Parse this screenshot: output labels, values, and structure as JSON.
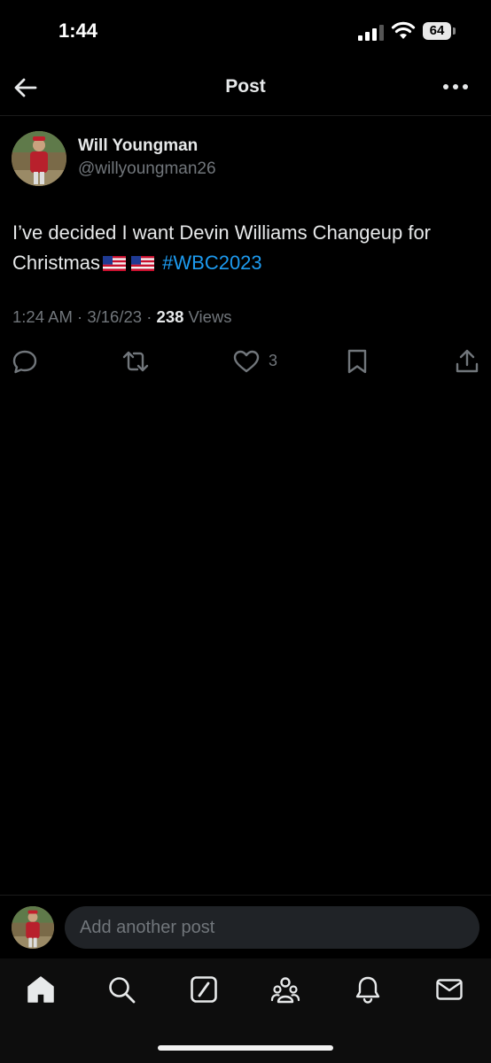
{
  "status_bar": {
    "time": "1:44",
    "battery": "64"
  },
  "header": {
    "title": "Post"
  },
  "post": {
    "author_name": "Will Youngman",
    "author_handle": "@willyoungman26",
    "text": "I’ve decided I want Devin Williams Changeup for Christmas",
    "hashtag": "#WBC2023",
    "time": "1:24 AM",
    "date": "3/16/23",
    "views_count": "238",
    "views_label": "Views",
    "like_count": "3"
  },
  "reply": {
    "placeholder": "Add another post"
  },
  "colors": {
    "background": "#000000",
    "accent": "#1d9bf0",
    "muted": "#71767b",
    "text": "#e7e9ea"
  },
  "icons": {
    "header": [
      "back-arrow-icon",
      "more-options-icon"
    ],
    "actions": [
      "reply-icon",
      "repost-icon",
      "like-icon",
      "bookmark-icon",
      "share-icon"
    ],
    "tabs": [
      "home-icon",
      "search-icon",
      "grok-icon",
      "communities-icon",
      "notifications-icon",
      "messages-icon"
    ]
  }
}
